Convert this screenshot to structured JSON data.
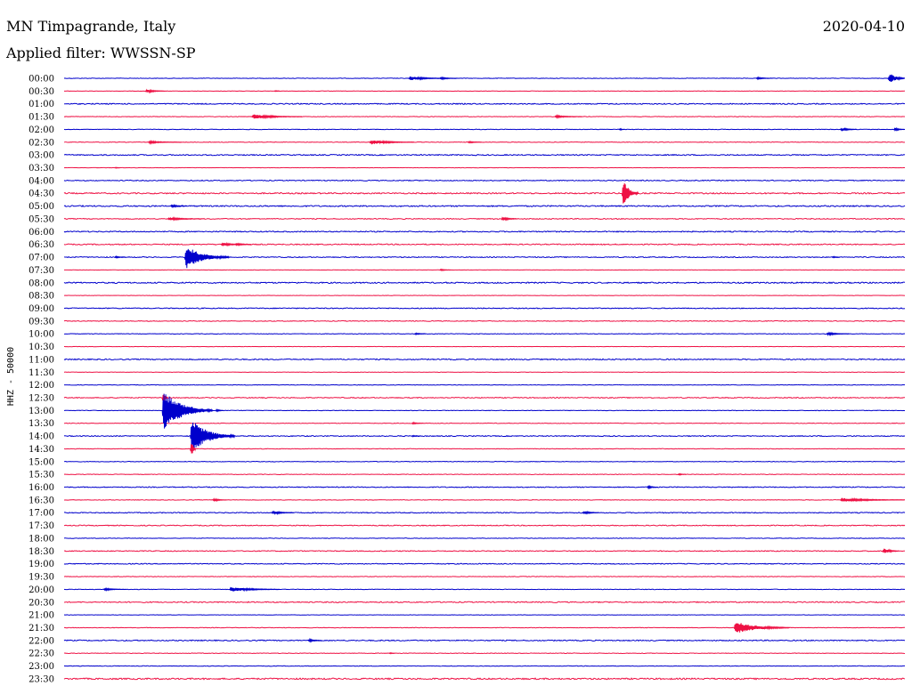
{
  "header": {
    "title": "MN Timpagrande, Italy",
    "filter": "Applied filter: WWSSN-SP",
    "date": "2020-04-10"
  },
  "chart_data": {
    "type": "line",
    "title": "MN Timpagrande, Italy",
    "subtitle": "Applied filter: WWSSN-SP",
    "ylabel": "HHZ - 50000",
    "xlabel": "",
    "colors": [
      "#0000cc",
      "#ee1144"
    ],
    "rows": [
      "00:00",
      "00:30",
      "01:00",
      "01:30",
      "02:00",
      "02:30",
      "03:00",
      "03:30",
      "04:00",
      "04:30",
      "05:00",
      "05:30",
      "06:00",
      "06:30",
      "07:00",
      "07:30",
      "08:00",
      "08:30",
      "09:00",
      "09:30",
      "10:00",
      "10:30",
      "11:00",
      "11:30",
      "12:00",
      "12:30",
      "13:00",
      "13:30",
      "14:00",
      "14:30",
      "15:00",
      "15:30",
      "16:00",
      "16:30",
      "17:00",
      "17:30",
      "18:00",
      "18:30",
      "19:00",
      "19:30",
      "20:00",
      "20:30",
      "21:00",
      "21:30",
      "22:00",
      "22:30",
      "23:00",
      "23:30"
    ],
    "minutes_per_row": 30,
    "noise": [
      0.3,
      0.2,
      0.6,
      0.3,
      0.3,
      0.3,
      0.6,
      0.2,
      0.5,
      0.7,
      0.7,
      0.5,
      0.6,
      0.6,
      0.5,
      0.2,
      0.7,
      0.2,
      0.5,
      0.4,
      0.3,
      0.2,
      0.6,
      0.2,
      0.3,
      0.5,
      0.3,
      0.3,
      0.5,
      0.3,
      0.3,
      0.3,
      0.5,
      0.3,
      0.5,
      0.5,
      0.3,
      0.5,
      0.5,
      0.3,
      0.3,
      0.6,
      0.2,
      0.3,
      0.6,
      0.3,
      0.3,
      0.8
    ],
    "events": [
      {
        "row": 0,
        "minute": 12.3,
        "amp": 2.5,
        "dur": 1.4
      },
      {
        "row": 0,
        "minute": 13.4,
        "amp": 1.5,
        "dur": 0.7
      },
      {
        "row": 0,
        "minute": 24.7,
        "amp": 1.5,
        "dur": 0.6
      },
      {
        "row": 0,
        "minute": 29.4,
        "amp": 9,
        "dur": 1.2
      },
      {
        "row": 1,
        "minute": 2.9,
        "amp": 2.5,
        "dur": 0.7
      },
      {
        "row": 1,
        "minute": 7.5,
        "amp": 1.5,
        "dur": 0.2
      },
      {
        "row": 3,
        "minute": 6.7,
        "amp": 3,
        "dur": 1.8
      },
      {
        "row": 3,
        "minute": 17.5,
        "amp": 1.5,
        "dur": 1.0
      },
      {
        "row": 4,
        "minute": 19.8,
        "amp": 2,
        "dur": 0.2
      },
      {
        "row": 4,
        "minute": 27.7,
        "amp": 2.5,
        "dur": 0.6
      },
      {
        "row": 4,
        "minute": 29.6,
        "amp": 2.5,
        "dur": 0.4
      },
      {
        "row": 5,
        "minute": 3.0,
        "amp": 1.5,
        "dur": 1.2
      },
      {
        "row": 5,
        "minute": 10.9,
        "amp": 3,
        "dur": 1.6
      },
      {
        "row": 5,
        "minute": 14.4,
        "amp": 1.5,
        "dur": 0.5
      },
      {
        "row": 7,
        "minute": 1.8,
        "amp": 1.5,
        "dur": 0.2
      },
      {
        "row": 9,
        "minute": 19.9,
        "amp": 20,
        "dur": 0.6
      },
      {
        "row": 10,
        "minute": 3.8,
        "amp": 2,
        "dur": 0.6
      },
      {
        "row": 11,
        "minute": 3.7,
        "amp": 2,
        "dur": 1.2
      },
      {
        "row": 11,
        "minute": 15.6,
        "amp": 3,
        "dur": 0.6
      },
      {
        "row": 13,
        "minute": 5.6,
        "amp": 2.5,
        "dur": 0.8
      },
      {
        "row": 13,
        "minute": 6.1,
        "amp": 2,
        "dur": 0.6
      },
      {
        "row": 14,
        "minute": 4.3,
        "amp": 15,
        "dur": 1.6
      },
      {
        "row": 14,
        "minute": 1.8,
        "amp": 1.5,
        "dur": 0.4
      },
      {
        "row": 14,
        "minute": 27.4,
        "amp": 1.5,
        "dur": 0.3
      },
      {
        "row": 15,
        "minute": 13.4,
        "amp": 1.5,
        "dur": 0.4
      },
      {
        "row": 20,
        "minute": 12.5,
        "amp": 1.5,
        "dur": 0.4
      },
      {
        "row": 20,
        "minute": 27.2,
        "amp": 2,
        "dur": 0.8
      },
      {
        "row": 25,
        "minute": 3.5,
        "amp": 18,
        "dur": 0.2
      },
      {
        "row": 26,
        "minute": 3.5,
        "amp": 26,
        "dur": 1.8
      },
      {
        "row": 26,
        "minute": 5.4,
        "amp": 2.5,
        "dur": 0.3
      },
      {
        "row": 26,
        "minute": 4.5,
        "amp": 14,
        "dur": 0.2
      },
      {
        "row": 27,
        "minute": 12.4,
        "amp": 1.5,
        "dur": 0.4
      },
      {
        "row": 28,
        "minute": 4.5,
        "amp": 22,
        "dur": 1.6
      },
      {
        "row": 28,
        "minute": 12.4,
        "amp": 1.5,
        "dur": 0.3
      },
      {
        "row": 29,
        "minute": 4.5,
        "amp": 20,
        "dur": 0.2
      },
      {
        "row": 31,
        "minute": 21.9,
        "amp": 1.5,
        "dur": 0.3
      },
      {
        "row": 32,
        "minute": 20.8,
        "amp": 2,
        "dur": 0.4
      },
      {
        "row": 33,
        "minute": 5.3,
        "amp": 2,
        "dur": 0.5
      },
      {
        "row": 33,
        "minute": 27.7,
        "amp": 2.5,
        "dur": 2.4
      },
      {
        "row": 34,
        "minute": 7.4,
        "amp": 2.5,
        "dur": 0.8
      },
      {
        "row": 34,
        "minute": 18.5,
        "amp": 2.5,
        "dur": 0.6
      },
      {
        "row": 37,
        "minute": 29.2,
        "amp": 4,
        "dur": 0.6
      },
      {
        "row": 40,
        "minute": 1.4,
        "amp": 1.5,
        "dur": 0.8
      },
      {
        "row": 40,
        "minute": 5.9,
        "amp": 3,
        "dur": 1.8
      },
      {
        "row": 43,
        "minute": 23.9,
        "amp": 8,
        "dur": 2.0
      },
      {
        "row": 44,
        "minute": 8.7,
        "amp": 2,
        "dur": 0.5
      },
      {
        "row": 45,
        "minute": 11.6,
        "amp": 1.5,
        "dur": 0.2
      }
    ]
  }
}
